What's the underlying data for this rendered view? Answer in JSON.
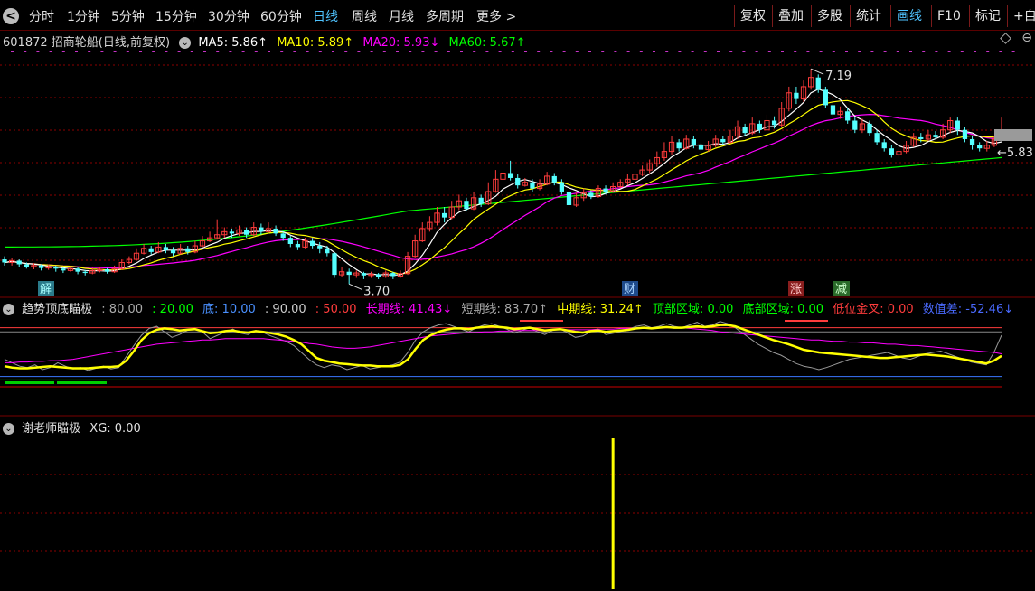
{
  "toolbar": {
    "back_label": "<",
    "periods": [
      "分时",
      "1分钟",
      "5分钟",
      "15分钟",
      "30分钟",
      "60分钟",
      "日线",
      "周线",
      "月线",
      "多周期",
      "更多 >"
    ],
    "active_period": "日线",
    "right_buttons": [
      "复权",
      "叠加",
      "多股",
      "统计",
      "画线",
      "F10",
      "标记",
      "+自"
    ],
    "active_right": "画线"
  },
  "main_legend": {
    "stock": "601872 招商轮船(日线,前复权)",
    "ma5": "MA5: 5.86↑",
    "ma10": "MA10: 5.89↑",
    "ma20": "MA20: 5.93↓",
    "ma60": "MA60: 5.67↑"
  },
  "ind1_legend": {
    "name": "趋势顶底瞄极",
    "v80": ": 80.00",
    "v20": ": 20.00",
    "bottom": "底: 10.00",
    "v90": ": 90.00",
    "v50": ": 50.00",
    "long": "长期线: 41.43↓",
    "short": "短期线: 83.70↑",
    "mid": "中期线: 31.24↑",
    "top_zone": "顶部区域: 0.00",
    "bottom_zone": "底部区域: 0.00",
    "golden": "低位金叉: 0.00",
    "diff": "数值差: -52.46↓"
  },
  "ind2_legend": {
    "name": "谢老师瞄极",
    "xg": "XG: 0.00"
  },
  "colors": {
    "up": "#ff3c3c",
    "down": "#54ffff",
    "ma5": "#ffffff",
    "ma10": "#ffff00",
    "ma20": "#ff00ff",
    "ma60": "#00ff00",
    "yellow_line": "#ffff00",
    "grid": "#8b0000"
  },
  "chart_data": {
    "type": "candlestick",
    "price_range": [
      3.5,
      7.5
    ],
    "high_label": "7.19",
    "low_label": "3.70",
    "last_label": "5.83",
    "event_labels": [
      "解",
      "财",
      "涨",
      "减"
    ],
    "candles": [
      [
        4.1,
        4.05,
        4.15,
        4.0
      ],
      [
        4.05,
        4.08,
        4.12,
        4.0
      ],
      [
        4.08,
        4.02,
        4.1,
        3.98
      ],
      [
        4.02,
        3.98,
        4.05,
        3.95
      ],
      [
        3.98,
        4.0,
        4.04,
        3.94
      ],
      [
        4.0,
        3.96,
        4.02,
        3.92
      ],
      [
        3.96,
        3.98,
        4.02,
        3.93
      ],
      [
        3.98,
        3.95,
        4.0,
        3.9
      ],
      [
        3.95,
        3.92,
        3.98,
        3.88
      ],
      [
        3.92,
        3.95,
        3.99,
        3.9
      ],
      [
        3.95,
        3.9,
        3.97,
        3.86
      ],
      [
        3.9,
        3.88,
        3.93,
        3.84
      ],
      [
        3.88,
        3.92,
        3.96,
        3.86
      ],
      [
        3.92,
        3.94,
        3.98,
        3.89
      ],
      [
        3.94,
        3.9,
        3.96,
        3.87
      ],
      [
        3.9,
        3.95,
        4.0,
        3.88
      ],
      [
        3.95,
        4.05,
        4.1,
        3.93
      ],
      [
        4.05,
        4.1,
        4.15,
        4.02
      ],
      [
        4.1,
        4.2,
        4.28,
        4.08
      ],
      [
        4.2,
        4.28,
        4.35,
        4.18
      ],
      [
        4.28,
        4.22,
        4.32,
        4.18
      ],
      [
        4.22,
        4.3,
        4.38,
        4.2
      ],
      [
        4.3,
        4.25,
        4.35,
        4.2
      ],
      [
        4.25,
        4.2,
        4.3,
        4.15
      ],
      [
        4.2,
        4.28,
        4.35,
        4.18
      ],
      [
        4.28,
        4.22,
        4.32,
        4.18
      ],
      [
        4.22,
        4.32,
        4.4,
        4.2
      ],
      [
        4.32,
        4.4,
        4.48,
        4.3
      ],
      [
        4.4,
        4.45,
        4.55,
        4.38
      ],
      [
        4.45,
        4.5,
        4.75,
        4.42
      ],
      [
        4.5,
        4.55,
        4.62,
        4.45
      ],
      [
        4.55,
        4.52,
        4.6,
        4.45
      ],
      [
        4.52,
        4.58,
        4.65,
        4.48
      ],
      [
        4.58,
        4.5,
        4.62,
        4.45
      ],
      [
        4.5,
        4.62,
        4.7,
        4.48
      ],
      [
        4.62,
        4.55,
        4.68,
        4.5
      ],
      [
        4.55,
        4.6,
        4.7,
        4.52
      ],
      [
        4.6,
        4.52,
        4.65,
        4.48
      ],
      [
        4.52,
        4.45,
        4.55,
        4.4
      ],
      [
        4.45,
        4.35,
        4.48,
        4.3
      ],
      [
        4.35,
        4.3,
        4.4,
        4.25
      ],
      [
        4.3,
        4.4,
        4.45,
        4.28
      ],
      [
        4.4,
        4.32,
        4.45,
        4.28
      ],
      [
        4.32,
        4.28,
        4.38,
        4.2
      ],
      [
        4.28,
        4.2,
        4.32,
        4.15
      ],
      [
        4.2,
        3.85,
        4.22,
        3.8
      ],
      [
        3.85,
        3.9,
        3.98,
        3.82
      ],
      [
        3.9,
        3.85,
        3.95,
        3.7
      ],
      [
        3.85,
        3.88,
        3.92,
        3.8
      ],
      [
        3.88,
        3.84,
        3.9,
        3.78
      ],
      [
        3.84,
        3.86,
        3.9,
        3.8
      ],
      [
        3.86,
        3.82,
        3.88,
        3.78
      ],
      [
        3.82,
        3.88,
        3.92,
        3.8
      ],
      [
        3.88,
        3.83,
        3.9,
        3.78
      ],
      [
        3.83,
        3.87,
        3.92,
        3.8
      ],
      [
        3.87,
        4.15,
        4.22,
        3.85
      ],
      [
        4.15,
        4.4,
        4.5,
        4.12
      ],
      [
        4.4,
        4.6,
        4.7,
        4.38
      ],
      [
        4.6,
        4.7,
        4.8,
        4.55
      ],
      [
        4.7,
        4.85,
        4.95,
        4.65
      ],
      [
        4.85,
        4.78,
        4.95,
        4.7
      ],
      [
        4.78,
        4.95,
        5.05,
        4.75
      ],
      [
        4.95,
        5.05,
        5.15,
        4.9
      ],
      [
        5.05,
        4.92,
        5.1,
        4.88
      ],
      [
        4.92,
        5.1,
        5.2,
        4.9
      ],
      [
        5.1,
        5.0,
        5.15,
        4.95
      ],
      [
        5.0,
        5.2,
        5.35,
        4.98
      ],
      [
        5.2,
        5.4,
        5.55,
        5.18
      ],
      [
        5.4,
        5.5,
        5.6,
        5.35
      ],
      [
        5.5,
        5.42,
        5.7,
        5.38
      ],
      [
        5.42,
        5.3,
        5.48,
        5.25
      ],
      [
        5.3,
        5.35,
        5.42,
        5.28
      ],
      [
        5.35,
        5.25,
        5.4,
        5.2
      ],
      [
        5.25,
        5.32,
        5.4,
        5.22
      ],
      [
        5.32,
        5.45,
        5.52,
        5.3
      ],
      [
        5.45,
        5.35,
        5.5,
        5.3
      ],
      [
        5.35,
        5.2,
        5.4,
        5.15
      ],
      [
        5.2,
        4.98,
        5.25,
        4.9
      ],
      [
        4.98,
        5.1,
        5.18,
        4.95
      ],
      [
        5.1,
        5.18,
        5.25,
        5.05
      ],
      [
        5.18,
        5.12,
        5.22,
        5.08
      ],
      [
        5.12,
        5.25,
        5.3,
        5.1
      ],
      [
        5.25,
        5.2,
        5.3,
        5.15
      ],
      [
        5.2,
        5.28,
        5.35,
        5.18
      ],
      [
        5.28,
        5.35,
        5.4,
        5.25
      ],
      [
        5.35,
        5.4,
        5.48,
        5.3
      ],
      [
        5.4,
        5.48,
        5.55,
        5.35
      ],
      [
        5.48,
        5.55,
        5.62,
        5.45
      ],
      [
        5.55,
        5.65,
        5.72,
        5.5
      ],
      [
        5.65,
        5.75,
        5.85,
        5.6
      ],
      [
        5.75,
        5.85,
        6.0,
        5.7
      ],
      [
        5.85,
        6.0,
        6.1,
        5.8
      ],
      [
        6.0,
        5.9,
        6.05,
        5.85
      ],
      [
        5.9,
        6.05,
        6.12,
        5.88
      ],
      [
        6.05,
        5.95,
        6.1,
        5.9
      ],
      [
        5.95,
        5.88,
        6.0,
        5.82
      ],
      [
        5.88,
        5.95,
        6.02,
        5.85
      ],
      [
        5.95,
        6.05,
        6.12,
        5.92
      ],
      [
        6.05,
        6.0,
        6.1,
        5.95
      ],
      [
        6.0,
        6.1,
        6.2,
        5.98
      ],
      [
        6.1,
        6.25,
        6.35,
        6.05
      ],
      [
        6.25,
        6.15,
        6.3,
        6.1
      ],
      [
        6.15,
        6.3,
        6.4,
        6.12
      ],
      [
        6.3,
        6.2,
        6.35,
        6.15
      ],
      [
        6.2,
        6.35,
        6.45,
        6.18
      ],
      [
        6.35,
        6.28,
        6.42,
        6.22
      ],
      [
        6.28,
        6.55,
        6.65,
        6.25
      ],
      [
        6.55,
        6.8,
        6.9,
        6.5
      ],
      [
        6.8,
        6.7,
        6.9,
        6.62
      ],
      [
        6.7,
        6.9,
        7.0,
        6.65
      ],
      [
        6.9,
        7.05,
        7.19,
        6.85
      ],
      [
        7.05,
        6.85,
        7.1,
        6.8
      ],
      [
        6.85,
        6.6,
        6.9,
        6.55
      ],
      [
        6.6,
        6.45,
        6.7,
        6.4
      ],
      [
        6.45,
        6.5,
        6.58,
        6.38
      ],
      [
        6.5,
        6.35,
        6.55,
        6.3
      ],
      [
        6.35,
        6.2,
        6.4,
        6.15
      ],
      [
        6.2,
        6.3,
        6.38,
        6.15
      ],
      [
        6.3,
        6.15,
        6.35,
        6.1
      ],
      [
        6.15,
        6.0,
        6.2,
        5.95
      ],
      [
        6.0,
        5.9,
        6.05,
        5.85
      ],
      [
        5.9,
        5.8,
        5.95,
        5.75
      ],
      [
        5.8,
        5.85,
        5.92,
        5.75
      ],
      [
        5.85,
        5.95,
        6.02,
        5.82
      ],
      [
        5.95,
        6.08,
        6.15,
        5.92
      ],
      [
        6.08,
        6.05,
        6.15,
        6.0
      ],
      [
        6.05,
        6.12,
        6.2,
        6.02
      ],
      [
        6.12,
        6.08,
        6.18,
        6.05
      ],
      [
        6.08,
        6.2,
        6.3,
        6.05
      ],
      [
        6.2,
        6.35,
        6.4,
        6.15
      ],
      [
        6.35,
        6.2,
        6.4,
        6.12
      ],
      [
        6.2,
        6.05,
        6.25,
        6.0
      ],
      [
        6.05,
        5.95,
        6.1,
        5.88
      ],
      [
        5.95,
        5.9,
        6.0,
        5.85
      ],
      [
        5.9,
        5.95,
        6.02,
        5.85
      ],
      [
        5.95,
        6.05,
        6.1,
        5.92
      ],
      [
        6.05,
        6.18,
        6.4,
        6.02
      ]
    ],
    "ind1": {
      "range": [
        0,
        100
      ],
      "yellow": [
        30,
        28,
        27,
        27,
        28,
        29,
        30,
        29,
        28,
        27,
        27,
        27,
        28,
        29,
        29,
        30,
        38,
        52,
        68,
        78,
        83,
        85,
        84,
        82,
        83,
        84,
        81,
        78,
        79,
        81,
        82,
        80,
        79,
        81,
        80,
        78,
        76,
        73,
        68,
        62,
        52,
        42,
        38,
        36,
        34,
        33,
        32,
        31,
        31,
        30,
        30,
        30,
        32,
        40,
        55,
        68,
        75,
        80,
        83,
        85,
        85,
        84,
        86,
        87,
        88,
        87,
        86,
        84,
        85,
        86,
        84,
        82,
        83,
        84,
        82,
        80,
        79,
        81,
        82,
        80,
        81,
        82,
        83,
        85,
        86,
        85,
        86,
        87,
        86,
        86,
        87,
        88,
        87,
        88,
        90,
        90,
        88,
        84,
        80,
        76,
        72,
        68,
        65,
        62,
        58,
        54,
        52,
        50,
        49,
        48,
        47,
        46,
        45,
        44,
        43,
        42,
        42,
        43,
        44,
        45,
        46,
        47,
        46,
        45,
        44,
        42,
        40,
        38,
        36,
        34,
        38,
        45
      ],
      "magenta": [
        35,
        35,
        36,
        36,
        37,
        37,
        38,
        38,
        39,
        40,
        42,
        44,
        46,
        48,
        50,
        52,
        54,
        56,
        58,
        60,
        62,
        63,
        64,
        65,
        66,
        67,
        68,
        68,
        69,
        70,
        70,
        70,
        70,
        70,
        70,
        69,
        68,
        67,
        66,
        65,
        63,
        62,
        60,
        58,
        57,
        56,
        56,
        57,
        58,
        60,
        62,
        64,
        66,
        68,
        70,
        72,
        74,
        75,
        76,
        77,
        78,
        79,
        79,
        80,
        80,
        81,
        81,
        82,
        82,
        82,
        82,
        82,
        83,
        83,
        83,
        83,
        83,
        83,
        84,
        84,
        84,
        85,
        85,
        85,
        85,
        86,
        86,
        86,
        86,
        86,
        85,
        84,
        83,
        82,
        80,
        79,
        78,
        77,
        76,
        75,
        74,
        73,
        72,
        71,
        70,
        69,
        68,
        68,
        67,
        66,
        66,
        65,
        65,
        64,
        64,
        63,
        62,
        62,
        61,
        60,
        60,
        59,
        58,
        57,
        56,
        55,
        54,
        53,
        52,
        51,
        50,
        48
      ],
      "gray": [
        40,
        35,
        30,
        28,
        32,
        25,
        28,
        35,
        30,
        26,
        28,
        24,
        27,
        30,
        26,
        28,
        44,
        60,
        75,
        85,
        88,
        80,
        72,
        76,
        82,
        85,
        80,
        70,
        75,
        80,
        84,
        78,
        76,
        82,
        79,
        74,
        70,
        66,
        60,
        50,
        40,
        32,
        28,
        32,
        30,
        25,
        28,
        31,
        26,
        28,
        30,
        32,
        36,
        50,
        68,
        80,
        86,
        90,
        92,
        88,
        84,
        80,
        86,
        90,
        92,
        88,
        84,
        78,
        82,
        86,
        80,
        76,
        82,
        85,
        78,
        72,
        74,
        80,
        84,
        76,
        78,
        80,
        84,
        88,
        90,
        86,
        88,
        92,
        88,
        86,
        90,
        94,
        88,
        90,
        95,
        92,
        86,
        78,
        70,
        62,
        56,
        50,
        46,
        40,
        34,
        30,
        28,
        25,
        28,
        32,
        36,
        40,
        42,
        44,
        46,
        48,
        50,
        46,
        42,
        40,
        44,
        48,
        50,
        52,
        48,
        44,
        40,
        36,
        34,
        32,
        50,
        75
      ],
      "red_line": 86,
      "blue_line": 15,
      "green_line": 10
    },
    "ind2": {
      "range": [
        0,
        1
      ],
      "signal_index": 83
    }
  }
}
